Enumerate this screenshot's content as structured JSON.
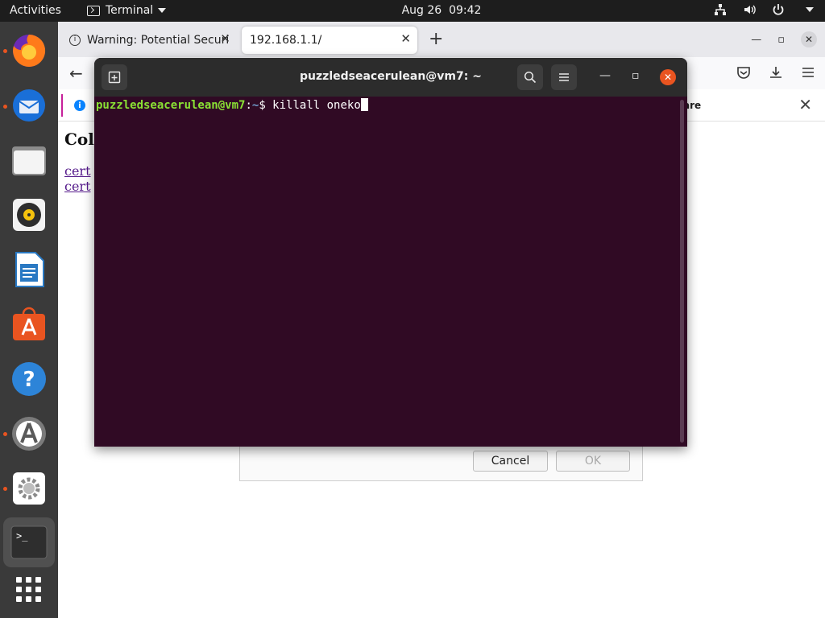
{
  "topbar": {
    "activities": "Activities",
    "app_name": "Terminal",
    "date": "Aug 26",
    "time": "09:42"
  },
  "dock": {
    "items": [
      "firefox-icon",
      "thunderbird-icon",
      "files-icon",
      "rhythmbox-icon",
      "libreoffice-writer-icon",
      "ubuntu-software-icon",
      "help-icon",
      "software-updater-icon",
      "settings-icon",
      "terminal-icon",
      "show-apps-icon"
    ]
  },
  "browser": {
    "tabs": [
      {
        "title": "Warning: Potential Securi"
      },
      {
        "title": "192.168.1.1/"
      }
    ],
    "notice_share": "are",
    "page": {
      "title": "Coll",
      "links": [
        "cert",
        "cert"
      ]
    }
  },
  "dialog": {
    "cancel_label": "Cancel",
    "ok_label": "OK"
  },
  "terminal": {
    "title": "puzzledseacerulean@vm7: ~",
    "prompt_user": "puzzledseacerulean@vm7",
    "prompt_sep": ":",
    "prompt_path": "~",
    "prompt_symbol": "$ ",
    "command": "killall oneko"
  },
  "colors": {
    "terminal_bg": "#300a24",
    "prompt_user": "#8ae234",
    "prompt_path": "#729fcf",
    "ubuntu_orange": "#e95420"
  }
}
